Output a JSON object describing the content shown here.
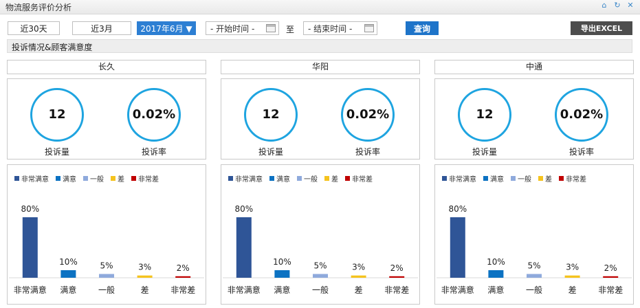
{
  "window": {
    "title": "物流服务评价分析"
  },
  "toolbar": {
    "btn_30days": "近30天",
    "btn_3months": "近3月",
    "btn_month": "2017年6月 ▼",
    "start_placeholder": "- 开始时间 -",
    "to_label": "至",
    "end_placeholder": "- 结束时间 -",
    "search_label": "查询",
    "export_label": "导出EXCEL"
  },
  "section": {
    "title": "投诉情况&顾客满意度"
  },
  "colors": {
    "very_satisfied": "#2f5597",
    "satisfied": "#0c72c2",
    "normal": "#8faadc",
    "bad": "#f5c31e",
    "very_bad": "#c00000",
    "ring": "#1ea4e0"
  },
  "legend": [
    "非常满意",
    "满意",
    "一般",
    "差",
    "非常差"
  ],
  "carriers": [
    {
      "name": "长久",
      "complaints": "12",
      "complaints_label": "投诉量",
      "complaint_rate": "0.02%",
      "complaint_rate_label": "投诉率",
      "chart_data": {
        "type": "bar",
        "categories": [
          "非常满意",
          "满意",
          "一般",
          "差",
          "非常差"
        ],
        "values": [
          80,
          10,
          5,
          3,
          2
        ],
        "value_labels": [
          "80%",
          "10%",
          "5%",
          "3%",
          "2%"
        ],
        "ylim": [
          0,
          100
        ]
      }
    },
    {
      "name": "华阳",
      "complaints": "12",
      "complaints_label": "投诉量",
      "complaint_rate": "0.02%",
      "complaint_rate_label": "投诉率",
      "chart_data": {
        "type": "bar",
        "categories": [
          "非常满意",
          "满意",
          "一般",
          "差",
          "非常差"
        ],
        "values": [
          80,
          10,
          5,
          3,
          2
        ],
        "value_labels": [
          "80%",
          "10%",
          "5%",
          "3%",
          "2%"
        ],
        "ylim": [
          0,
          100
        ]
      }
    },
    {
      "name": "中通",
      "complaints": "12",
      "complaints_label": "投诉量",
      "complaint_rate": "0.02%",
      "complaint_rate_label": "投诉率",
      "chart_data": {
        "type": "bar",
        "categories": [
          "非常满意",
          "满意",
          "一般",
          "差",
          "非常差"
        ],
        "values": [
          80,
          10,
          5,
          3,
          2
        ],
        "value_labels": [
          "80%",
          "10%",
          "5%",
          "3%",
          "2%"
        ],
        "ylim": [
          0,
          100
        ]
      }
    }
  ]
}
